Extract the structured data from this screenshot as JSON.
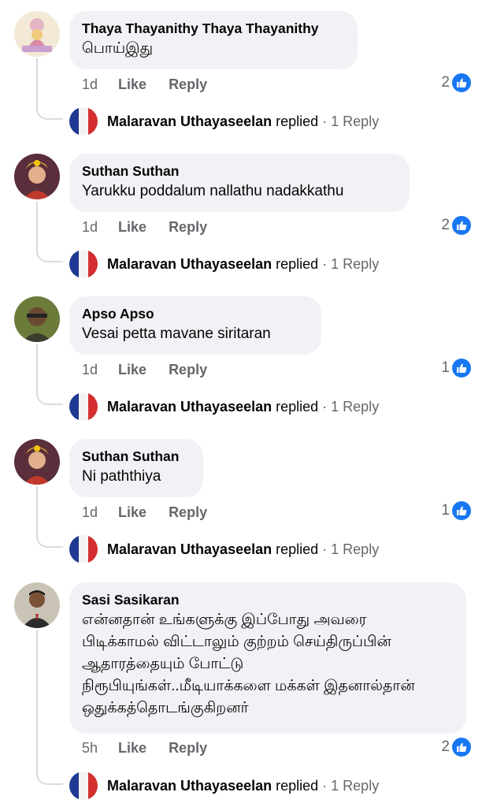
{
  "comments": [
    {
      "author": "Thaya Thayanithy Thaya Thayanithy",
      "text": "பொய்இது",
      "time": "1d",
      "like_label": "Like",
      "reply_label": "Reply",
      "reaction_count": "2",
      "reply_author": "Malaravan Uthayaseelan",
      "reply_verb": "replied",
      "reply_dot": "·",
      "reply_count": "1 Reply"
    },
    {
      "author": "Suthan Suthan",
      "text": "Yarukku poddalum nallathu nadakkathu",
      "time": "1d",
      "like_label": "Like",
      "reply_label": "Reply",
      "reaction_count": "2",
      "reply_author": "Malaravan Uthayaseelan",
      "reply_verb": "replied",
      "reply_dot": "·",
      "reply_count": "1 Reply"
    },
    {
      "author": "Apso Apso",
      "text": "Vesai petta mavane siritaran",
      "time": "1d",
      "like_label": "Like",
      "reply_label": "Reply",
      "reaction_count": "1",
      "reply_author": "Malaravan Uthayaseelan",
      "reply_verb": "replied",
      "reply_dot": "·",
      "reply_count": "1 Reply"
    },
    {
      "author": "Suthan Suthan",
      "text": "Ni paththiya",
      "time": "1d",
      "like_label": "Like",
      "reply_label": "Reply",
      "reaction_count": "1",
      "reply_author": "Malaravan Uthayaseelan",
      "reply_verb": "replied",
      "reply_dot": "·",
      "reply_count": "1 Reply"
    },
    {
      "author": "Sasi Sasikaran",
      "text": "என்னதான் உங்களுக்கு இப்போது அவரை\nபிடிக்காமல் விட்டாலும் குற்றம் செய்திருப்பின்\nஆதாரத்தையும் போட்டு\nநிரூபியுங்கள்..மீடியாக்களை மக்கள் இதனால்தான்\nஒதுக்கத்தொடங்குகிறனர்",
      "time": "5h",
      "like_label": "Like",
      "reply_label": "Reply",
      "reaction_count": "2",
      "reply_author": "Malaravan Uthayaseelan",
      "reply_verb": "replied",
      "reply_dot": "·",
      "reply_count": "1 Reply"
    }
  ],
  "icons": {
    "like": "like-thumbs-up-icon",
    "avatar": "user-avatar",
    "reply_avatar": "french-flag-avatar"
  },
  "colors": {
    "like_blue": "#1877f2",
    "bubble_bg": "#f0f2f5",
    "meta_gray": "#65676b"
  }
}
